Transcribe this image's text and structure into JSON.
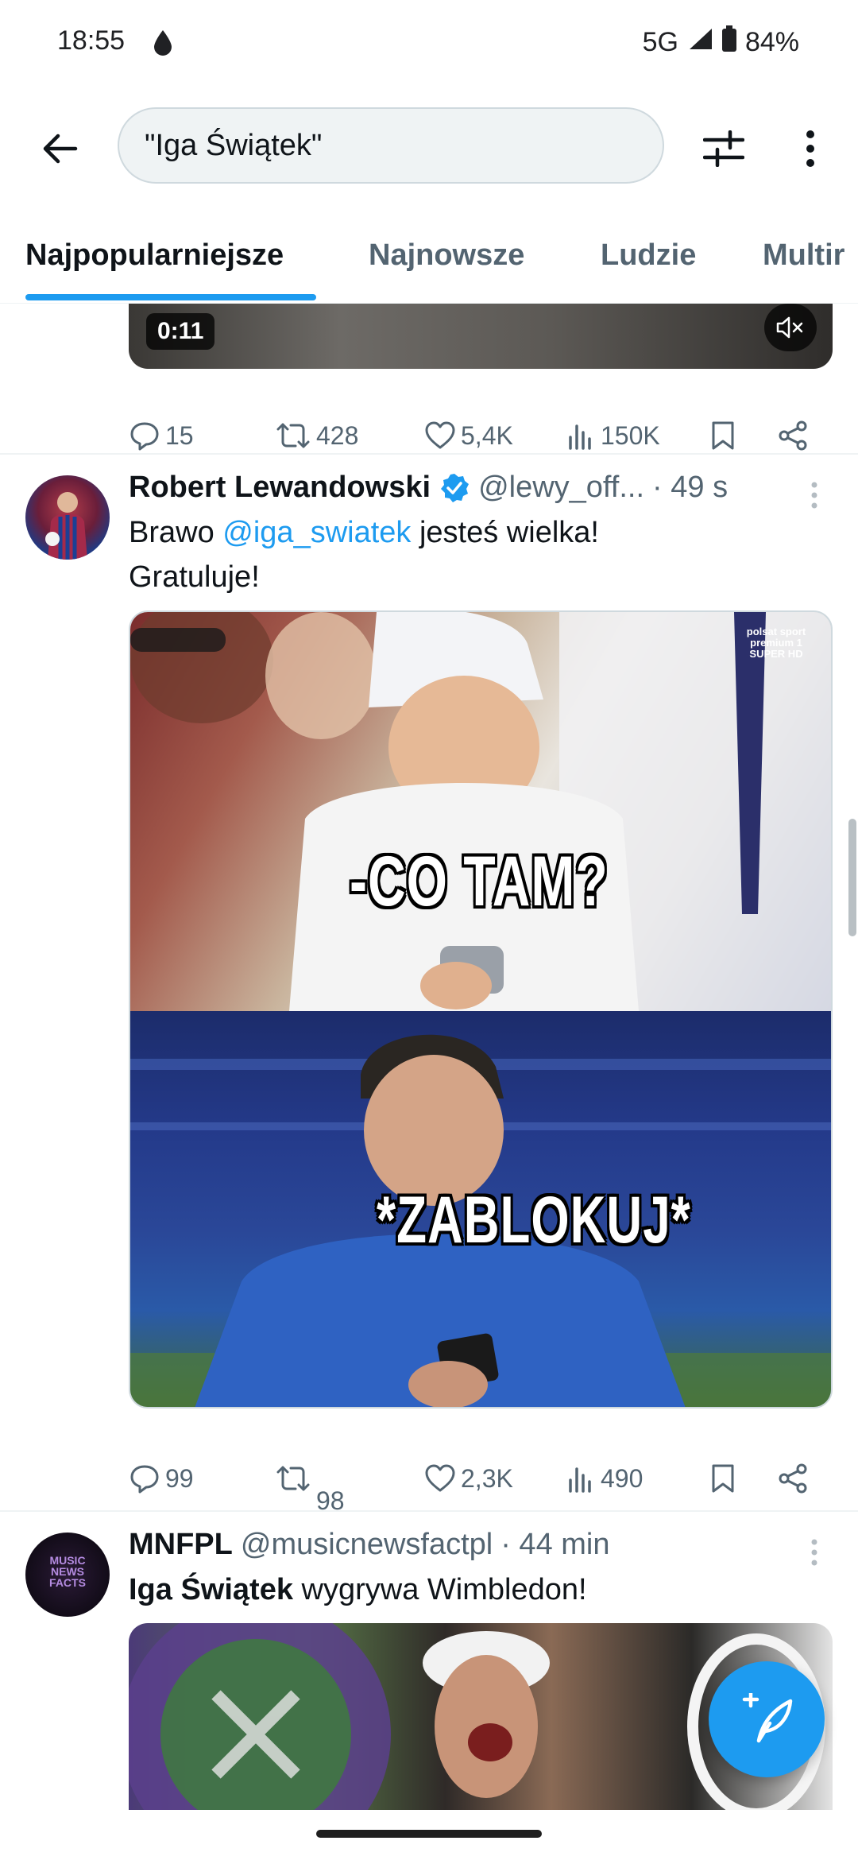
{
  "status_bar": {
    "time": "18:55",
    "network": "5G",
    "battery": "84%"
  },
  "search": {
    "query": "\"Iga Świątek\""
  },
  "tabs": [
    {
      "label": "Najpopularniejsze"
    },
    {
      "label": "Najnowsze"
    },
    {
      "label": "Ludzie"
    },
    {
      "label": "Multir"
    }
  ],
  "previous_tweet": {
    "video_time": "0:11",
    "replies": "15",
    "retweets": "428",
    "likes": "5,4K",
    "views": "150K"
  },
  "tweet1": {
    "name": "Robert Lewandowski",
    "handle": "@lewy_off...",
    "time": "· 49 s",
    "text_before": "Brawo ",
    "mention": "@iga_swiatek",
    "text_after": " jesteś wielka!",
    "text_line2": "Gratuluje!",
    "meme_top_caption": "-CO TAM?",
    "meme_bottom_caption": "*ZABLOKUJ*",
    "logo_text": "polsat sport premium 1",
    "logo_sub": "SUPER HD",
    "replies": "99",
    "retweets": "98",
    "likes": "2,3K",
    "views": "490"
  },
  "tweet2": {
    "name": "MNFPL",
    "handle": "@musicnewsfactpl",
    "time": "· 44 min",
    "avatar_text": "MUSIC NEWS FACTS",
    "text_bold": "Iga Świątek",
    "text_rest": " wygrywa Wimbledon!"
  },
  "colors": {
    "accent": "#1d9bf0",
    "text": "#0f1419",
    "muted": "#536471"
  }
}
